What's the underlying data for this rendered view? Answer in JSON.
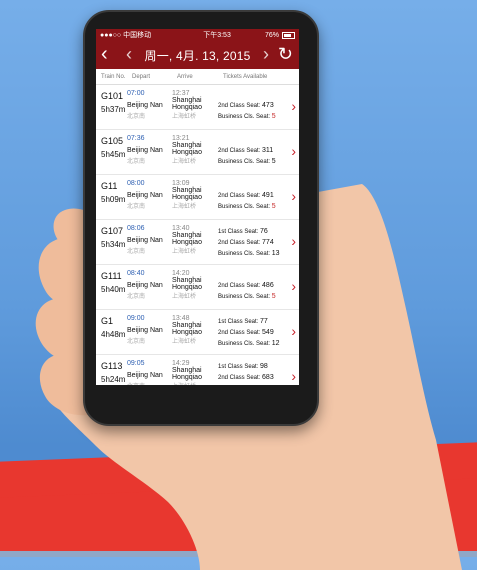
{
  "status_bar": {
    "carrier": "●●●○○ 中国移动",
    "time": "下午3:53",
    "battery": "76%"
  },
  "navbar": {
    "back": "‹",
    "prev": "‹",
    "title": "周一, 4月. 13, 2015",
    "next": "›",
    "refresh": "↻"
  },
  "columns": [
    "Train No.",
    "Depart",
    "Arrive",
    "Tickets Available"
  ],
  "trains": [
    {
      "number": "G101",
      "duration": "5h37m",
      "depart_time": "07:00",
      "depart_station": "Beijing Nan",
      "depart_cn": "北京南",
      "arrive_time": "12:37",
      "arrive_station_1": "Shanghai",
      "arrive_station_2": "Hongqiao",
      "arrive_cn": "上海虹桥",
      "seat_1_label": "",
      "seat_1_value": "",
      "seat_2_label": "2nd Class Seat:",
      "seat_2_value": "473",
      "seat_3_label": "Business Cls. Seat:",
      "seat_3_value": "5",
      "seat_3_red": true
    },
    {
      "number": "G105",
      "duration": "5h45m",
      "depart_time": "07:36",
      "depart_station": "Beijing Nan",
      "depart_cn": "北京南",
      "arrive_time": "13:21",
      "arrive_station_1": "Shanghai",
      "arrive_station_2": "Hongqiao",
      "arrive_cn": "上海虹桥",
      "seat_1_label": "",
      "seat_1_value": "",
      "seat_2_label": "2nd Class Seat:",
      "seat_2_value": "311",
      "seat_3_label": "Business Cls. Seat:",
      "seat_3_value": "5",
      "seat_3_red": false
    },
    {
      "number": "G11",
      "duration": "5h09m",
      "depart_time": "08:00",
      "depart_station": "Beijing Nan",
      "depart_cn": "北京南",
      "arrive_time": "13:09",
      "arrive_station_1": "Shanghai",
      "arrive_station_2": "Hongqiao",
      "arrive_cn": "上海虹桥",
      "seat_1_label": "",
      "seat_1_value": "",
      "seat_2_label": "2nd Class Seat:",
      "seat_2_value": "491",
      "seat_3_label": "Business Cls. Seat:",
      "seat_3_value": "5",
      "seat_3_red": true
    },
    {
      "number": "G107",
      "duration": "5h34m",
      "depart_time": "08:06",
      "depart_station": "Beijing Nan",
      "depart_cn": "北京南",
      "arrive_time": "13:40",
      "arrive_station_1": "Shanghai",
      "arrive_station_2": "Hongqiao",
      "arrive_cn": "上海虹桥",
      "seat_1_label": "1st Class Seat:",
      "seat_1_value": "76",
      "seat_2_label": "2nd Class Seat:",
      "seat_2_value": "774",
      "seat_3_label": "Business Cls. Seat:",
      "seat_3_value": "13",
      "seat_3_red": false
    },
    {
      "number": "G111",
      "duration": "5h40m",
      "depart_time": "08:40",
      "depart_station": "Beijing Nan",
      "depart_cn": "北京南",
      "arrive_time": "14:20",
      "arrive_station_1": "Shanghai",
      "arrive_station_2": "Hongqiao",
      "arrive_cn": "上海虹桥",
      "seat_1_label": "",
      "seat_1_value": "",
      "seat_2_label": "2nd Class Seat:",
      "seat_2_value": "486",
      "seat_3_label": "Business Cls. Seat:",
      "seat_3_value": "5",
      "seat_3_red": true
    },
    {
      "number": "G1",
      "duration": "4h48m",
      "depart_time": "09:00",
      "depart_station": "Beijing Nan",
      "depart_cn": "北京南",
      "arrive_time": "13:48",
      "arrive_station_1": "Shanghai",
      "arrive_station_2": "Hongqiao",
      "arrive_cn": "上海虹桥",
      "seat_1_label": "1st Class Seat:",
      "seat_1_value": "77",
      "seat_2_label": "2nd Class Seat:",
      "seat_2_value": "549",
      "seat_3_label": "Business Cls. Seat:",
      "seat_3_value": "12",
      "seat_3_red": false
    },
    {
      "number": "G113",
      "duration": "5h24m",
      "depart_time": "09:05",
      "depart_station": "Beijing Nan",
      "depart_cn": "北京南",
      "arrive_time": "14:29",
      "arrive_station_1": "Shanghai",
      "arrive_station_2": "Hongqiao",
      "arrive_cn": "上海虹桥",
      "seat_1_label": "1st Class Seat:",
      "seat_1_value": "98",
      "seat_2_label": "2nd Class Seat:",
      "seat_2_value": "683",
      "seat_3_label": "",
      "seat_3_value": "",
      "seat_3_red": false
    }
  ]
}
